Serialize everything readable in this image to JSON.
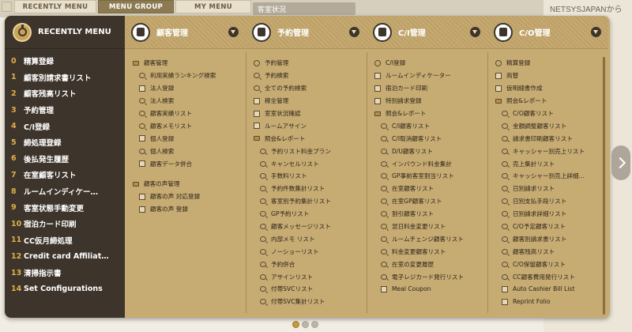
{
  "tabs": [
    "RECENTLY MENU",
    "MENU GROUP",
    "MY MENU"
  ],
  "background": {
    "right_title": "NETSYSJAPANから",
    "mid_strip": "客室状況"
  },
  "left": {
    "title": "RECENTLY MENU",
    "items": [
      {
        "num": "0",
        "label": "精算登録"
      },
      {
        "num": "1",
        "label": "顧客別請求書リスト"
      },
      {
        "num": "2",
        "label": "顧客残高リスト"
      },
      {
        "num": "3",
        "label": "予約管理"
      },
      {
        "num": "4",
        "label": "C/I登録"
      },
      {
        "num": "5",
        "label": "締処理登録"
      },
      {
        "num": "6",
        "label": "後払発生履歴"
      },
      {
        "num": "7",
        "label": "在室顧客リスト"
      },
      {
        "num": "8",
        "label": "ルームインディケー…"
      },
      {
        "num": "9",
        "label": "客室状態手動変更"
      },
      {
        "num": "10",
        "label": "宿泊カード印刷"
      },
      {
        "num": "11",
        "label": "CC仮月締処理"
      },
      {
        "num": "12",
        "label": "Credit card Affiliat…"
      },
      {
        "num": "13",
        "label": "清掃指示書"
      },
      {
        "num": "14",
        "label": "Set Configurations"
      }
    ]
  },
  "columns": [
    {
      "title": "顧客管理",
      "rows": [
        {
          "icon": "folder",
          "label": "顧客管理",
          "sub": false
        },
        {
          "icon": "search",
          "label": "利用実績ランキング検索",
          "sub": true
        },
        {
          "icon": "doc",
          "label": "法人登録",
          "sub": true
        },
        {
          "icon": "search",
          "label": "法人検索",
          "sub": true
        },
        {
          "icon": "search",
          "label": "顧客実績リスト",
          "sub": true
        },
        {
          "icon": "search",
          "label": "顧客メモリスト",
          "sub": true
        },
        {
          "icon": "doc",
          "label": "個人登録",
          "sub": true
        },
        {
          "icon": "search",
          "label": "個人検索",
          "sub": true
        },
        {
          "icon": "doc",
          "label": "顧客データ併合",
          "sub": true
        },
        {
          "gap": true
        },
        {
          "icon": "folder",
          "label": "顧客の声管理",
          "sub": false
        },
        {
          "icon": "doc",
          "label": "顧客の声 対応登録",
          "sub": true
        },
        {
          "icon": "doc",
          "label": "顧客の声 登録",
          "sub": true
        }
      ]
    },
    {
      "title": "予約管理",
      "rows": [
        {
          "icon": "clock",
          "label": "予約管理",
          "sub": false
        },
        {
          "icon": "search",
          "label": "予約検索",
          "sub": false
        },
        {
          "icon": "search",
          "label": "全ての予約検索",
          "sub": false
        },
        {
          "icon": "doc",
          "label": "稼全管理",
          "sub": false
        },
        {
          "icon": "doc",
          "label": "室室状況確認",
          "sub": false
        },
        {
          "icon": "doc",
          "label": "ルームアサイン",
          "sub": false
        },
        {
          "icon": "folder",
          "label": "照会&レポート",
          "sub": false
        },
        {
          "icon": "search",
          "label": "予約リスト料金プラン",
          "sub": true
        },
        {
          "icon": "search",
          "label": "キャンセルリスト",
          "sub": true
        },
        {
          "icon": "search",
          "label": "手数料リスト",
          "sub": true
        },
        {
          "icon": "search",
          "label": "予約件数集計リスト",
          "sub": true
        },
        {
          "icon": "search",
          "label": "客室別予約集計リスト",
          "sub": true
        },
        {
          "icon": "search",
          "label": "GP予約リスト",
          "sub": true
        },
        {
          "icon": "search",
          "label": "顧客メッセージリスト",
          "sub": true
        },
        {
          "icon": "search",
          "label": "内部メモ リスト",
          "sub": true
        },
        {
          "icon": "search",
          "label": "ノーショーリスト",
          "sub": true
        },
        {
          "icon": "search",
          "label": "予約併合",
          "sub": true
        },
        {
          "icon": "search",
          "label": "アサインリスト",
          "sub": true
        },
        {
          "icon": "search",
          "label": "付帯SVCリスト",
          "sub": true
        },
        {
          "icon": "search",
          "label": "付帯SVC集計リスト",
          "sub": true
        }
      ]
    },
    {
      "title": "C/I管理",
      "rows": [
        {
          "icon": "clock",
          "label": "C/I登録",
          "sub": false
        },
        {
          "icon": "doc",
          "label": "ルームインディケーター",
          "sub": false
        },
        {
          "icon": "doc",
          "label": "宿泊カード印刷",
          "sub": false
        },
        {
          "icon": "doc",
          "label": "特別請求登録",
          "sub": false
        },
        {
          "icon": "folder",
          "label": "照会&レポート",
          "sub": false
        },
        {
          "icon": "search",
          "label": "C/I顧客リスト",
          "sub": true
        },
        {
          "icon": "search",
          "label": "C/I取消顧客リスト",
          "sub": true
        },
        {
          "icon": "search",
          "label": "D/U顧客リスト",
          "sub": true
        },
        {
          "icon": "search",
          "label": "インバウンド料金集計",
          "sub": true
        },
        {
          "icon": "search",
          "label": "GP事前客室割当リスト",
          "sub": true
        },
        {
          "icon": "search",
          "label": "在室顧客リスト",
          "sub": true
        },
        {
          "icon": "search",
          "label": "在室GP顧客リスト",
          "sub": true
        },
        {
          "icon": "search",
          "label": "割引顧客リスト",
          "sub": true
        },
        {
          "icon": "search",
          "label": "翌日料金変更リスト",
          "sub": true
        },
        {
          "icon": "search",
          "label": "ルームチェンジ顧客リスト",
          "sub": true
        },
        {
          "icon": "search",
          "label": "料金変更顧客リスト",
          "sub": true
        },
        {
          "icon": "search",
          "label": "在室の変更履歴",
          "sub": true
        },
        {
          "icon": "search",
          "label": "電子レジカード発行リスト",
          "sub": true
        },
        {
          "icon": "doc",
          "label": "Meal Coupon",
          "sub": true
        }
      ]
    },
    {
      "title": "C/O管理",
      "rows": [
        {
          "icon": "clock",
          "label": "精算登録",
          "sub": false
        },
        {
          "icon": "doc",
          "label": "両替",
          "sub": false
        },
        {
          "icon": "doc",
          "label": "仮明細書作成",
          "sub": false
        },
        {
          "icon": "folder",
          "label": "照会&レポート",
          "sub": false
        },
        {
          "icon": "search",
          "label": "C/O顧客リスト",
          "sub": true
        },
        {
          "icon": "search",
          "label": "金額調整顧客リスト",
          "sub": true
        },
        {
          "icon": "search",
          "label": "請求書印刷顧客リスト",
          "sub": true
        },
        {
          "icon": "search",
          "label": "キャッシャー別売上リスト",
          "sub": true
        },
        {
          "icon": "search",
          "label": "売上集計リスト",
          "sub": true
        },
        {
          "icon": "search",
          "label": "キャッシャー別売上詳細…",
          "sub": true
        },
        {
          "icon": "search",
          "label": "日別請求リスト",
          "sub": true
        },
        {
          "icon": "search",
          "label": "日別支払手段リスト",
          "sub": true
        },
        {
          "icon": "search",
          "label": "日別請求詳細リスト",
          "sub": true
        },
        {
          "icon": "search",
          "label": "C/O予定顧客リスト",
          "sub": true
        },
        {
          "icon": "search",
          "label": "顧客別請求書リスト",
          "sub": true
        },
        {
          "icon": "search",
          "label": "顧客残高リスト",
          "sub": true
        },
        {
          "icon": "search",
          "label": "C/O保留顧客リスト",
          "sub": true
        },
        {
          "icon": "search",
          "label": "CC顧客費用発行リスト",
          "sub": true
        },
        {
          "icon": "doc",
          "label": "Auto Cashier Bill List",
          "sub": true
        },
        {
          "icon": "doc",
          "label": "Reprint Folio",
          "sub": true
        }
      ]
    }
  ],
  "pager": {
    "total": 3,
    "active": 0
  }
}
